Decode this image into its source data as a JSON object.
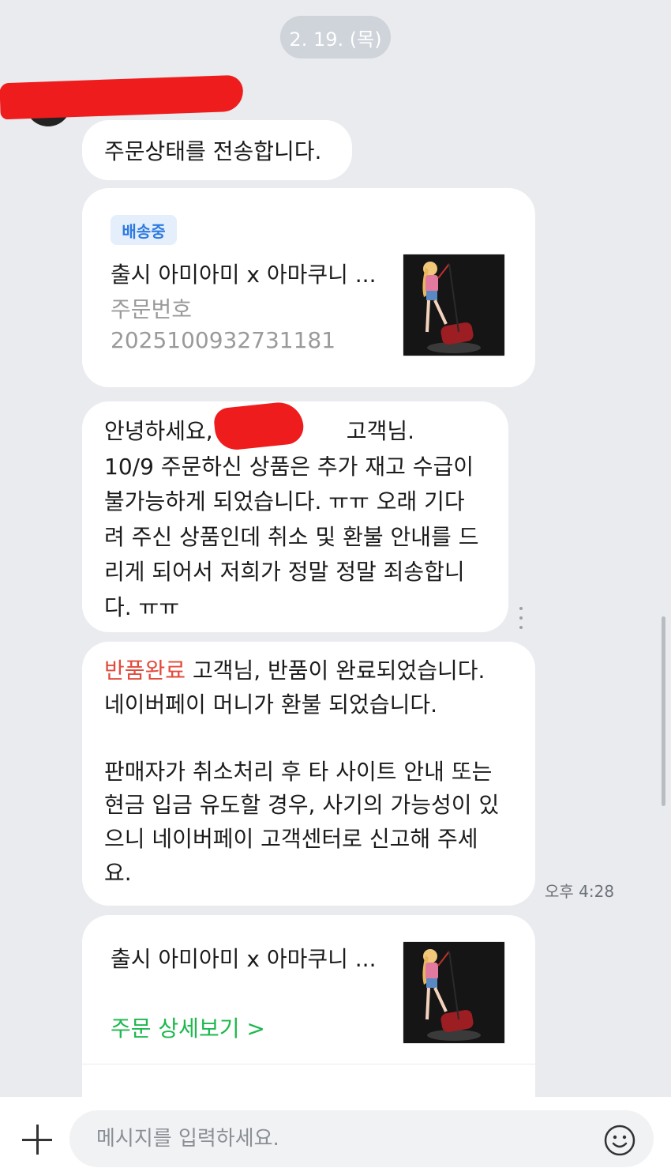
{
  "date_divider": "2. 19. (목)",
  "messages": {
    "status_intro": "주문상태를 전송합니다.",
    "order_card": {
      "badge": "배송중",
      "product_title": "출시 아미아미 x 아마쿠니 ...",
      "order_label": "주문번호",
      "order_number": "2025100932731181"
    },
    "notice_lines": [
      "안녕하세요,                   고객님.",
      "10/9 주문하신 상품은 추가 재고 수급이",
      "불가능하게 되었습니다. ㅠㅠ 오래 기다",
      "려 주신 상품인데 취소 및 환불 안내를 드",
      "리게 되어서 저희가 정말 정말 죄송합니",
      "다. ㅠㅠ"
    ],
    "return_notice": {
      "highlight": "반품완료",
      "line1_rest": " 고객님, 반품이 완료되었습니다.",
      "line2": "네이버페이 머니가 환불 되었습니다.",
      "warning_lines": [
        "판매자가 취소처리 후 타 사이트 안내 또는",
        "현금 입금 유도할 경우, 사기의 가능성이 있",
        "으니 네이버페이 고객센터로 신고해 주세",
        "요."
      ]
    },
    "timestamp": "오후 4:28",
    "detail_card": {
      "product_title": "출시 아미아미 x 아마쿠니 ...",
      "link_label": "주문 상세보기 >"
    }
  },
  "composer": {
    "placeholder": "메시지를 입력하세요."
  },
  "colors": {
    "background": "#e9ebef",
    "badge_text": "#2e7ae0",
    "highlight_red": "#e24a3b",
    "link_green": "#1cb84e",
    "redaction": "#ee1c1c"
  },
  "icons": [
    "plus-icon",
    "emoji-icon",
    "more-options-icon"
  ]
}
